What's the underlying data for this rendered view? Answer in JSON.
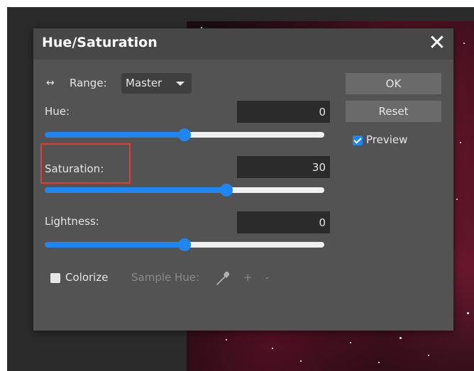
{
  "dialog": {
    "title": "Hue/Saturation",
    "close_icon": "close-icon",
    "range_icon": "↔",
    "range_label": "Range:",
    "range_value": "Master",
    "hue": {
      "label": "Hue:",
      "value": "0",
      "slider_value": 0,
      "slider_min": -180,
      "slider_max": 180
    },
    "saturation": {
      "label": "Saturation:",
      "value": "30",
      "slider_value": 30,
      "slider_min": -100,
      "slider_max": 100
    },
    "lightness": {
      "label": "Lightness:",
      "value": "0",
      "slider_value": 0,
      "slider_min": -100,
      "slider_max": 100
    },
    "ok_label": "OK",
    "reset_label": "Reset",
    "preview_label": "Preview",
    "preview_checked": true,
    "colorize_label": "Colorize",
    "colorize_checked": false,
    "sample_hue_label": "Sample Hue:",
    "eyedropper_icon": "eyedropper-icon",
    "plus_label": "+",
    "minus_label": "-"
  },
  "colors": {
    "accent": "#1e86f0",
    "highlight": "#e83a2e"
  }
}
